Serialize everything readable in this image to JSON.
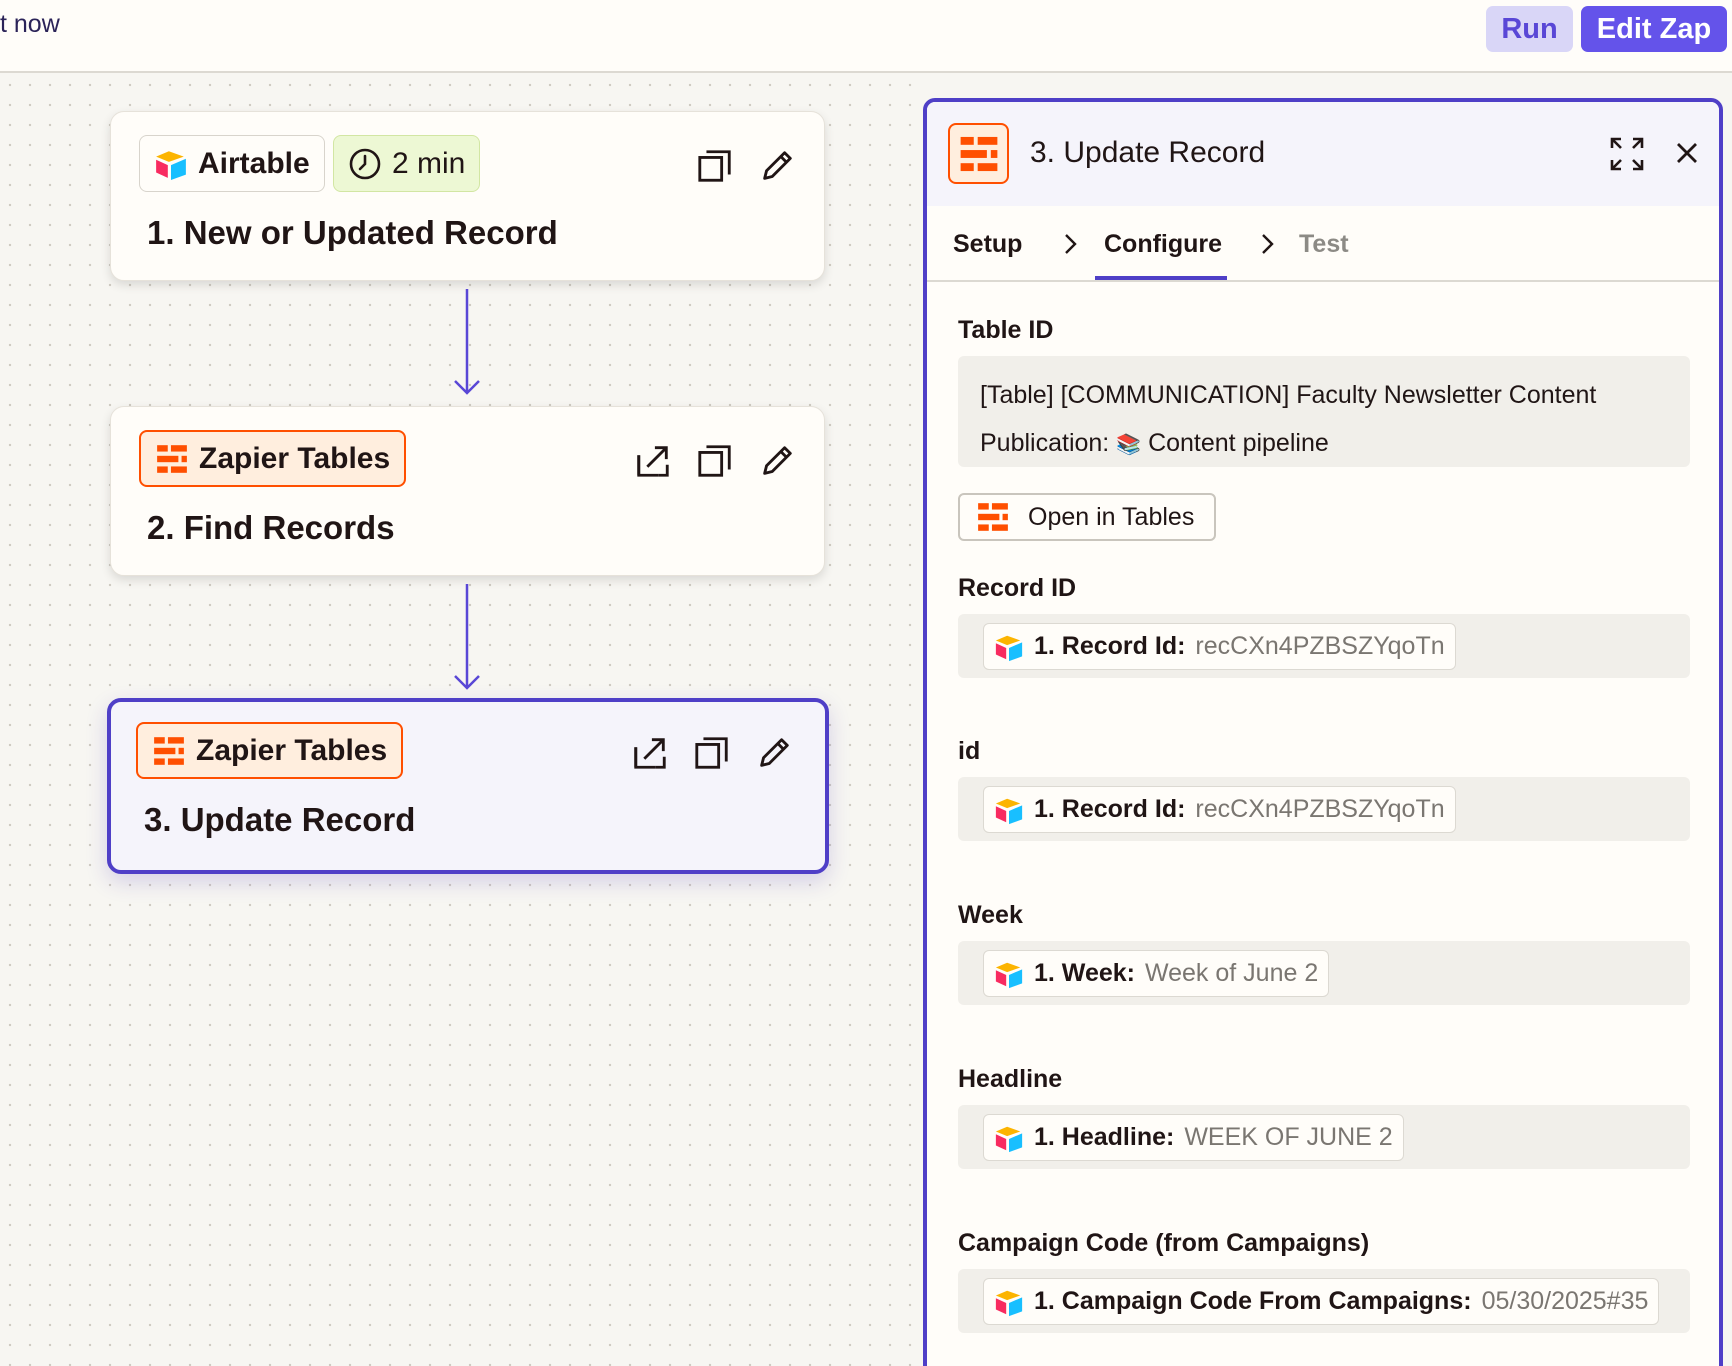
{
  "topbar": {
    "status_text": "t now",
    "run_label": "Run",
    "edit_label": "Edit Zap"
  },
  "steps": [
    {
      "app": "Airtable",
      "timer": "2 min",
      "title": "1. New or Updated Record"
    },
    {
      "app": "Zapier Tables",
      "title": "2. Find Records"
    },
    {
      "app": "Zapier Tables",
      "title": "3. Update Record"
    }
  ],
  "panel": {
    "title": "3. Update Record",
    "tabs": [
      "Setup",
      "Configure",
      "Test"
    ],
    "active_tab": "Configure",
    "table_id": {
      "label": "Table ID",
      "line1": "[Table] [COMMUNICATION] Faculty Newsletter Content",
      "line2_prefix": "Publication:",
      "line2_emoji": "📚",
      "line2_value": "Content pipeline"
    },
    "open_button": "Open in Tables",
    "fields": [
      {
        "label": "Record ID",
        "key": "1. Record Id:",
        "value": "recCXn4PZBSZYqoTn"
      },
      {
        "label": "id",
        "key": "1. Record Id:",
        "value": "recCXn4PZBSZYqoTn"
      },
      {
        "label": "Week",
        "key": "1. Week:",
        "value": "Week of June 2"
      },
      {
        "label": "Headline",
        "key": "1. Headline:",
        "value": "WEEK OF JUNE 2"
      },
      {
        "label": "Campaign Code (from Campaigns)",
        "key": "1. Campaign Code From Campaigns:",
        "value": "05/30/2025#35"
      }
    ]
  },
  "colors": {
    "accent": "#4f3fc7",
    "zapier_orange": "#ff4f00",
    "run_bg": "#d9d6f7",
    "edit_bg": "#6453ea"
  },
  "icons": [
    "airtable-icon",
    "clock-icon",
    "zapier-tables-icon",
    "duplicate-icon",
    "pencil-icon",
    "open-external-icon",
    "expand-icon",
    "close-icon",
    "chevron-right-icon",
    "arrow-down-icon"
  ]
}
